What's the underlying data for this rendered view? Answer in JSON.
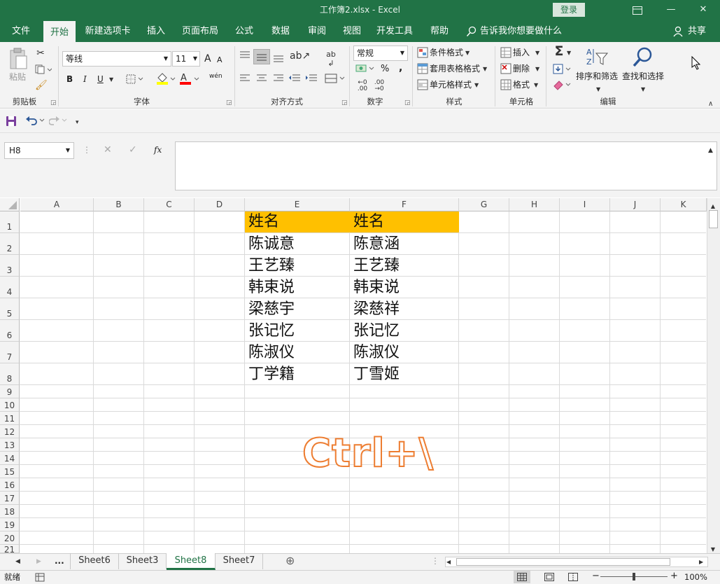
{
  "window": {
    "title": "工作簿2.xlsx  -  Excel",
    "login_label": "登录",
    "minimize": "—",
    "restore": "❐",
    "close": "✕"
  },
  "menu": {
    "tabs": [
      "文件",
      "开始",
      "新建选项卡",
      "插入",
      "页面布局",
      "公式",
      "数据",
      "审阅",
      "视图",
      "开发工具",
      "帮助"
    ],
    "tell_me": "告诉我你想要做什么",
    "share": "共享"
  },
  "ribbon": {
    "clipboard": {
      "paste": "粘贴",
      "group": "剪贴板"
    },
    "font": {
      "name": "等线",
      "size": "11",
      "grow": "A",
      "shrink": "A",
      "bold": "B",
      "italic": "I",
      "underline": "U",
      "pinyin": "wén",
      "font_color_letter": "A",
      "group": "字体"
    },
    "alignment": {
      "group": "对齐方式"
    },
    "number": {
      "format": "常规",
      "percent": "%",
      "comma": ",",
      "group": "数字"
    },
    "styles": {
      "conditional": "条件格式",
      "table": "套用表格格式",
      "cell_styles": "单元格样式",
      "group": "样式"
    },
    "cells": {
      "insert": "插入",
      "delete": "删除",
      "format": "格式",
      "group": "单元格"
    },
    "editing": {
      "sort_filter": "排序和筛选",
      "find_select": "查找和选择",
      "group": "编辑"
    }
  },
  "formula_bar": {
    "name_box": "H8",
    "fx": "fx",
    "value": ""
  },
  "columns": [
    "A",
    "B",
    "C",
    "D",
    "E",
    "F",
    "G",
    "H",
    "I",
    "J",
    "K"
  ],
  "rows": [
    "1",
    "2",
    "3",
    "4",
    "5",
    "6",
    "7",
    "8",
    "9",
    "10",
    "11",
    "12",
    "13",
    "14",
    "15",
    "16",
    "17",
    "18",
    "19",
    "20",
    "21"
  ],
  "cells": {
    "E": [
      "姓名",
      "陈诚意",
      "王艺臻",
      "韩束说",
      "梁慈宇",
      "张记忆",
      "陈淑仪",
      "丁学籍"
    ],
    "F": [
      "姓名",
      "陈意涵",
      "王艺臻",
      "韩束说",
      "梁慈祥",
      "张记忆",
      "陈淑仪",
      "丁雪姬"
    ]
  },
  "colors": {
    "header_fill": "#ffc000",
    "accent": "#217346",
    "overlay": "#ed7d31"
  },
  "overlay_text": "Ctrl+\\",
  "sheets": {
    "ellipsis": "...",
    "tabs": [
      "Sheet6",
      "Sheet3",
      "Sheet8",
      "Sheet7"
    ],
    "active": "Sheet8",
    "add": "⊕"
  },
  "status": {
    "ready": "就绪",
    "zoom": "100%",
    "minus": "−",
    "plus": "+"
  }
}
